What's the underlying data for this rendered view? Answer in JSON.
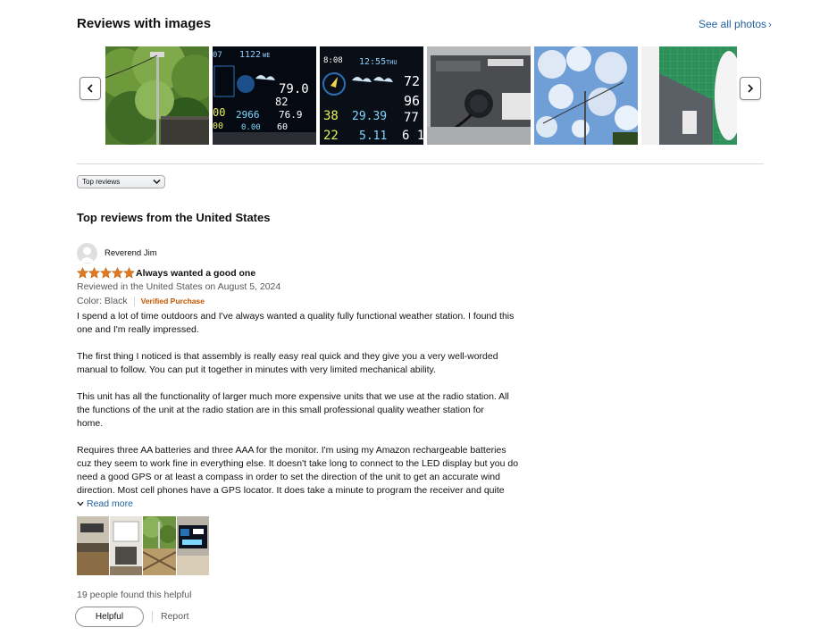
{
  "images_section": {
    "title": "Reviews with images",
    "see_all": "See all photos",
    "lcd1": {
      "r1": "07",
      "r2": "1122",
      "r2b": "WE",
      "v1": "79.0",
      "v2": "82",
      "v3": "00",
      "v4": "2966",
      "v5": "76.9",
      "v6": "00",
      "v7": "0.00",
      "v8": "60"
    },
    "lcd2": {
      "r1": "8:08",
      "r2": "12:55",
      "r2b": "THU",
      "v1": "72",
      "v2": "96",
      "v3": "38",
      "v4": "29.39",
      "v5": "77",
      "v6": "22",
      "v7": "5.11",
      "v8": "6 1"
    }
  },
  "sort": {
    "selected": "Top reviews"
  },
  "section_title": "Top reviews from the United States",
  "review": {
    "reviewer": "Reverend Jim",
    "rating": 5,
    "headline": "Always wanted a good one",
    "date_line": "Reviewed in the United States on August 5, 2024",
    "color": "Color: Black",
    "verified": "Verified Purchase",
    "p1a": "I spend a lot of time outdoors and I've always wanted a quality fully functional weather station. I found this",
    "p1b": "one and I'm really impressed.",
    "p2a": "The first thing I noticed is that assembly is really easy real quick and they give you a very well-worded",
    "p2b": "manual to follow. You can put it together in minutes with very limited mechanical ability.",
    "p3a": "This unit has all the functionality of larger much more expensive units that we use at the radio station. All",
    "p3b": "the functions of the unit at the radio station are in this small professional quality weather station for",
    "p3c": "home.",
    "p4a": "Requires three AA batteries and three AAA for the monitor. I'm using my Amazon rechargeable batteries",
    "p4b": "cuz they seem to work fine in everything else. It doesn't take long to connect to the LED display but you do",
    "p4c": "need a good GPS or at least a compass in order to set the direction of the unit to get an accurate wind",
    "p4d": "direction. Most cell phones have a GPS locator. It does take a minute to program the receiver and quite",
    "read_more": "Read more",
    "helpful_count": "19 people found this helpful",
    "helpful_btn": "Helpful",
    "report": "Report"
  },
  "colors": {
    "star": "#de7921",
    "link": "#2162a1",
    "verified": "#c45500"
  }
}
